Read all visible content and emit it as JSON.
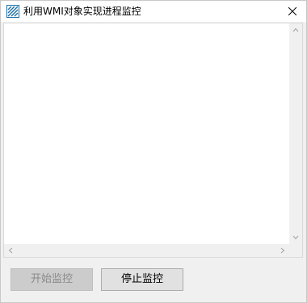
{
  "window": {
    "title": "利用WMI对象实现进程监控"
  },
  "process_list": {
    "items": []
  },
  "buttons": {
    "start_label": "开始监控",
    "start_enabled": false,
    "stop_label": "停止监控",
    "stop_enabled": true
  },
  "icons": {
    "app": "app-icon",
    "close": "close-icon",
    "scroll_up": "chevron-up-icon",
    "scroll_down": "chevron-down-icon",
    "scroll_left": "chevron-left-icon",
    "scroll_right": "chevron-right-icon"
  },
  "colors": {
    "titlebar": "#ffffff",
    "client_bg": "#f0f0f0",
    "app_icon": "#1d6fa5"
  }
}
